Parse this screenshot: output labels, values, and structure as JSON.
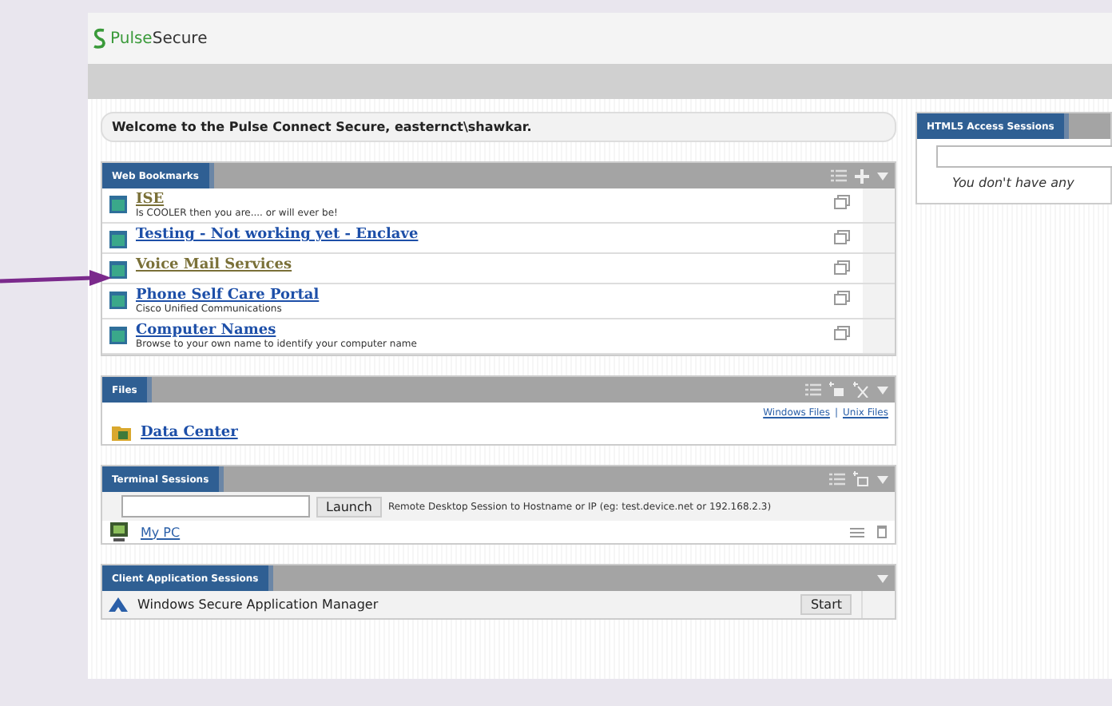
{
  "brand": {
    "name_part_1": "Pulse",
    "name_part_2": "Secure"
  },
  "welcome": "Welcome to the Pulse Connect Secure, easternct\\shawkar.",
  "panels": [
    {
      "kind": "bookmarks",
      "title": "Web Bookmarks",
      "items": [
        {
          "title": "ISE",
          "description": "Is COOLER then you are.... or will ever be!",
          "visited": true
        },
        {
          "title": "Testing - Not working yet - Enclave",
          "visited": false
        },
        {
          "title": "Voice Mail Services",
          "visited": true
        },
        {
          "title": "Phone Self Care Portal",
          "description": "Cisco Unified Communications",
          "visited": false
        },
        {
          "title": "Computer Names",
          "description": "Browse to your own name to identify your computer name",
          "visited": false
        }
      ]
    },
    {
      "kind": "files",
      "title": "Files",
      "links": [
        "Windows Files",
        "Unix Files"
      ],
      "separator": "|",
      "items": [
        {
          "title": "Data Center"
        }
      ]
    },
    {
      "kind": "terminal",
      "title": "Terminal Sessions",
      "button": "Launch",
      "hint": "Remote Desktop Session to Hostname or IP (eg: test.device.net or 192.168.2.3)",
      "items": [
        {
          "title": "My PC"
        }
      ]
    },
    {
      "kind": "client",
      "title": "Client Application Sessions",
      "items": [
        {
          "title": "Windows Secure Application Manager",
          "button": "Start"
        }
      ]
    }
  ],
  "side_panel": {
    "title": "HTML5 Access Sessions",
    "message": "You don't have any"
  }
}
